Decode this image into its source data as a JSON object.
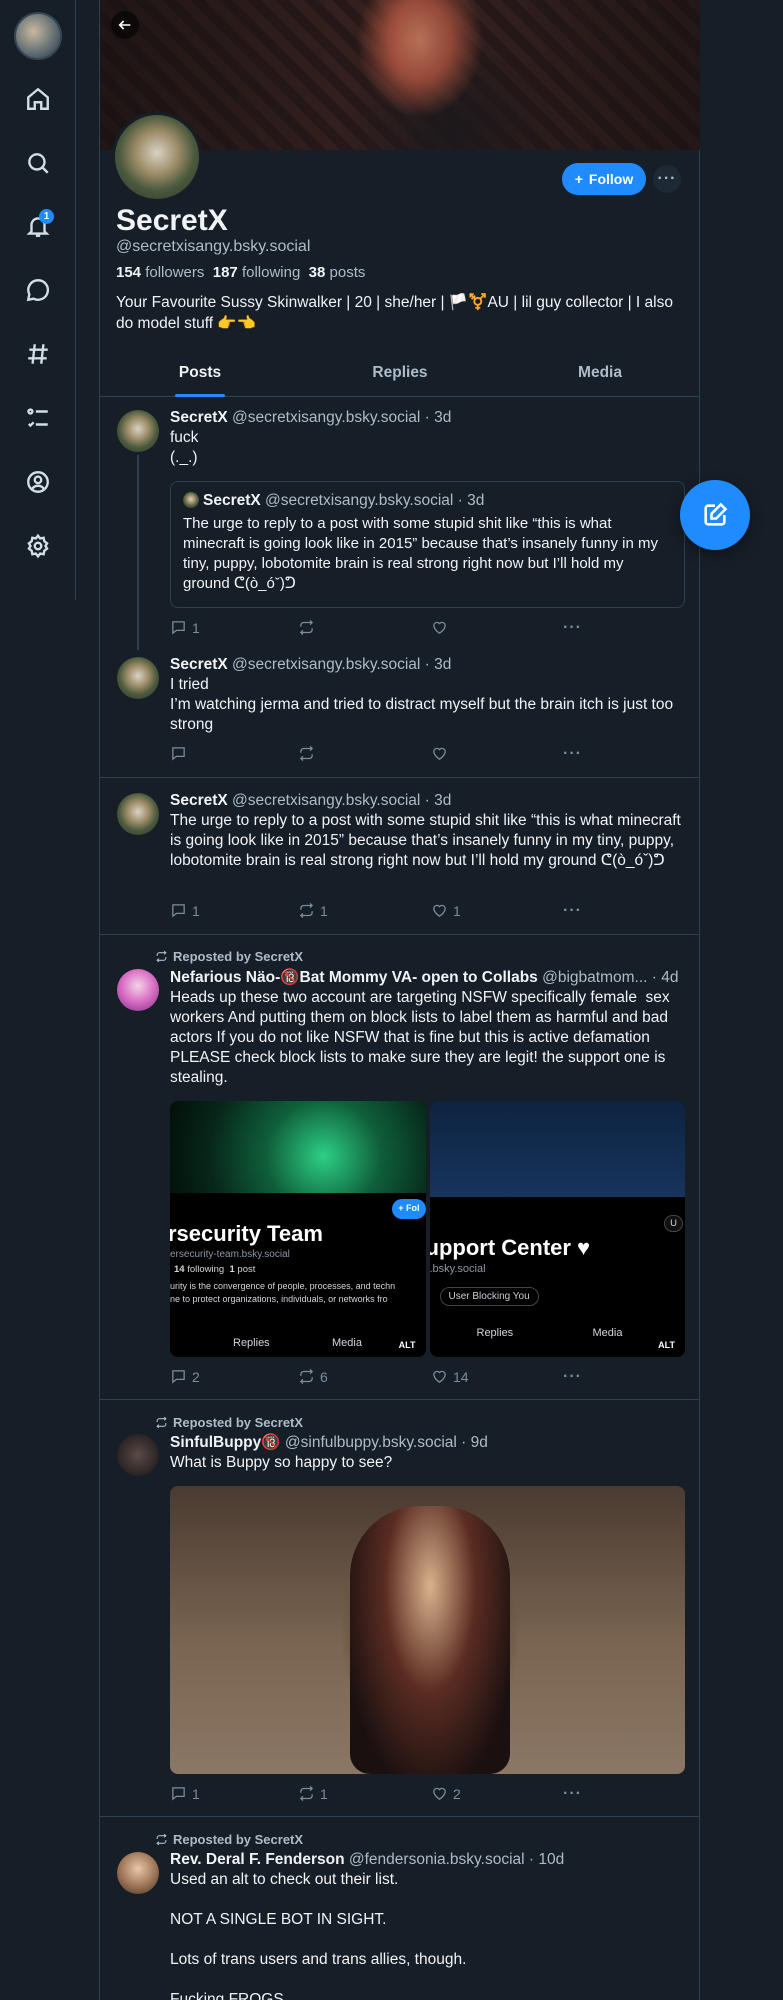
{
  "profile": {
    "display_name": "SecretX",
    "handle": "@secretxisangy.bsky.social",
    "followers_count": "154",
    "followers_label": "followers",
    "following_count": "187",
    "following_label": "following",
    "posts_count": "38",
    "posts_label": "posts",
    "bio": "Your Favourite Sussy Skinwalker | 20 | she/her | 🏳️⚧️AU | lil guy collector | I also do model stuff 👉👈",
    "follow_label": "Follow"
  },
  "nav": {
    "notification_badge": "1",
    "icons": [
      "home-icon",
      "search-icon",
      "bell-icon",
      "chat-icon",
      "hashtag-icon",
      "list-icon",
      "profile-icon",
      "gear-icon"
    ]
  },
  "tabs": [
    {
      "label": "Posts"
    },
    {
      "label": "Replies"
    },
    {
      "label": "Media"
    }
  ],
  "posts": [
    {
      "name": "SecretX",
      "handle": "@secretxisangy.bsky.social",
      "time": "· 3d",
      "text": "fuck\n(._.)",
      "quote": {
        "name": "SecretX",
        "handle": "@secretxisangy.bsky.social",
        "time": "· 3d",
        "text": "The urge to reply to a post with some stupid shit like “this is what minecraft is going look like in 2015” because that’s insanely funny in my tiny, puppy, lobotomite brain is real strong right now but I’ll hold my ground ᕦ(ò_óˇ)ᕤ"
      },
      "replies": "1",
      "reposts": "",
      "likes": ""
    },
    {
      "name": "SecretX",
      "handle": "@secretxisangy.bsky.social",
      "time": "· 3d",
      "text": "I tried\nI’m watching jerma and tried to distract myself but the brain itch is just too strong",
      "replies": "",
      "reposts": "",
      "likes": ""
    },
    {
      "name": "SecretX",
      "handle": "@secretxisangy.bsky.social",
      "time": "· 3d",
      "text": "The urge to reply to a post with some stupid shit like “this is what minecraft is going look like in 2015” because that’s insanely funny in my tiny, puppy, lobotomite brain is real strong right now but I’ll hold my ground ᕦ(ò_óˇ)ᕤ",
      "replies": "1",
      "reposts": "1",
      "likes": "1"
    },
    {
      "repost_label": "Reposted by SecretX",
      "name": "Nefarious Näo-🔞Bat Mommy VA- open to Collabs",
      "handle": "@bigbatmom...",
      "time": "· 4d",
      "text": "Heads up these two account are targeting NSFW specifically female  sex workers And putting them on block lists to label them as harmful and bad actors If you do not like NSFW that is fine but this is active defamation PLEASE check block lists to make sure they are legit! the support one is stealing.",
      "media": [
        {
          "title": "rsecurity Team",
          "sub": "ersecurity-team.bsky.social",
          "following": "14",
          "following_label": "following",
          "posts": "1",
          "posts_label": "post",
          "desc1": "urity is the convergence of people, processes, and techn",
          "desc2": "ne to protect organizations, individuals, or networks fro",
          "tab1": "Replies",
          "tab2": "Media",
          "follow": "+ Fol",
          "alt": "ALT"
        },
        {
          "title": "upport Center ♥",
          "sub": ".bsky.social",
          "pill": "User Blocking You",
          "tab1": "Replies",
          "tab2": "Media",
          "alt": "ALT",
          "u": "U"
        }
      ],
      "replies": "2",
      "reposts": "6",
      "likes": "14"
    },
    {
      "repost_label": "Reposted by SecretX",
      "name": "SinfulBuppy🔞",
      "handle": "@sinfulbuppy.bsky.social",
      "time": "· 9d",
      "text": "What is Buppy so happy to see?",
      "replies": "1",
      "reposts": "1",
      "likes": "2"
    },
    {
      "repost_label": "Reposted by SecretX",
      "name": "Rev. Deral F. Fenderson",
      "handle": "@fendersonia.bsky.social",
      "time": "· 10d",
      "text": "Used an alt to check out their list.\n\nNOT A SINGLE BOT IN SIGHT.\n\nLots of trans users and trans allies, though.\n\nFucking FROGS."
    }
  ],
  "colors": {
    "accent": "#208bfe",
    "background": "#161e27",
    "border": "#2e4052",
    "muted": "#aebbc9"
  }
}
